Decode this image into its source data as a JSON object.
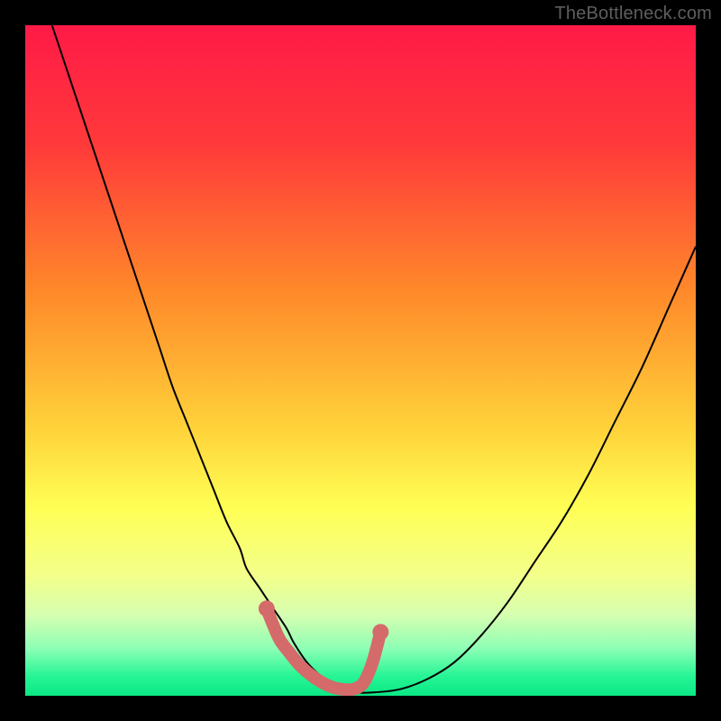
{
  "watermark": "TheBottleneck.com",
  "chart_data": {
    "type": "line",
    "title": "",
    "xlabel": "",
    "ylabel": "",
    "xlim": [
      0,
      100
    ],
    "ylim": [
      0,
      100
    ],
    "background_gradient": {
      "stops": [
        {
          "offset": 0,
          "color": "#ff1a47"
        },
        {
          "offset": 18,
          "color": "#ff3a3a"
        },
        {
          "offset": 40,
          "color": "#ff8a2a"
        },
        {
          "offset": 60,
          "color": "#ffd23a"
        },
        {
          "offset": 72,
          "color": "#ffff55"
        },
        {
          "offset": 82,
          "color": "#f3ff8a"
        },
        {
          "offset": 88,
          "color": "#d6ffb0"
        },
        {
          "offset": 93,
          "color": "#8cffb5"
        },
        {
          "offset": 97,
          "color": "#28f596"
        },
        {
          "offset": 100,
          "color": "#0ae884"
        }
      ]
    },
    "series": [
      {
        "name": "bottleneck-curve",
        "color": "#000000",
        "width": 2,
        "x": [
          4,
          6,
          8,
          10,
          12,
          14,
          16,
          18,
          20,
          22,
          24,
          26,
          28,
          30,
          32,
          33,
          35,
          37,
          39,
          40,
          42,
          44,
          46,
          47,
          48,
          52,
          56,
          60,
          64,
          68,
          72,
          76,
          80,
          84,
          88,
          92,
          96,
          100
        ],
        "y": [
          100,
          94,
          88,
          82,
          76,
          70,
          64,
          58,
          52,
          46,
          41,
          36,
          31,
          26,
          22,
          19,
          16,
          13,
          10,
          8,
          5,
          3,
          1.5,
          0.8,
          0.5,
          0.5,
          1,
          2.5,
          5,
          9,
          14,
          20,
          26,
          33,
          41,
          49,
          58,
          67
        ]
      },
      {
        "name": "optimal-band-marker",
        "color": "#d46a6a",
        "width": 14,
        "linecap": "round",
        "x": [
          36,
          37,
          38,
          39.5,
          41,
          43,
          45,
          47,
          49,
          50.5,
          51.8,
          53
        ],
        "y": [
          13,
          10.5,
          8.3,
          6.3,
          4.5,
          2.8,
          1.6,
          1.0,
          1.0,
          2.0,
          5.0,
          9.5
        ]
      }
    ],
    "dots": {
      "name": "optimal-band-endpoints",
      "color": "#d46a6a",
      "radius": 9,
      "points": [
        {
          "x": 36,
          "y": 13
        },
        {
          "x": 53,
          "y": 9.5
        }
      ]
    }
  }
}
